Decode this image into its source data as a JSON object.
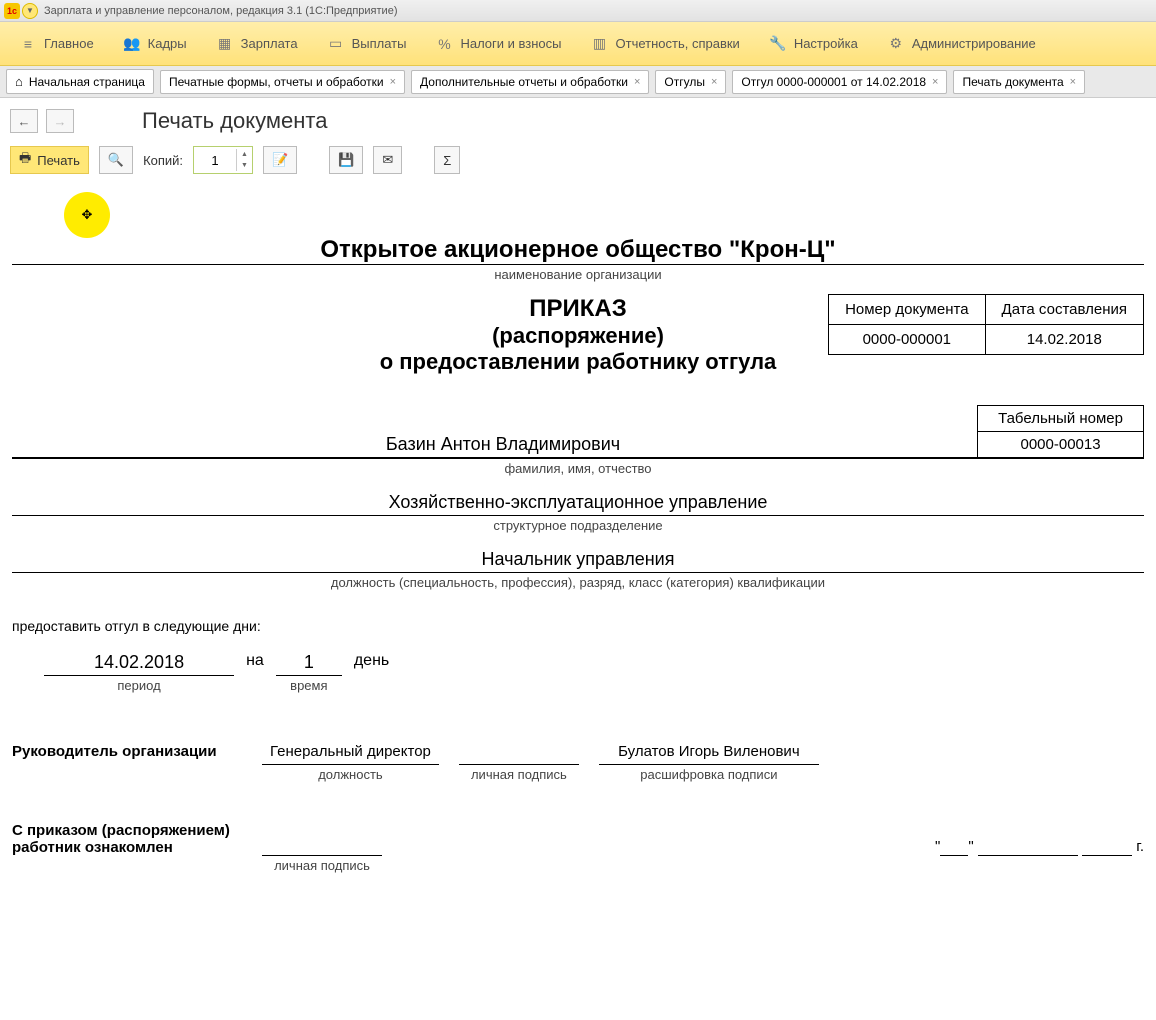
{
  "titlebar": {
    "text": "Зарплата и управление персоналом, редакция 3.1  (1С:Предприятие)"
  },
  "menu": {
    "items": [
      {
        "label": "Главное"
      },
      {
        "label": "Кадры"
      },
      {
        "label": "Зарплата"
      },
      {
        "label": "Выплаты"
      },
      {
        "label": "Налоги и взносы"
      },
      {
        "label": "Отчетность, справки"
      },
      {
        "label": "Настройка"
      },
      {
        "label": "Администрирование"
      }
    ]
  },
  "tabs": {
    "items": [
      {
        "label": "Начальная страница",
        "home": true
      },
      {
        "label": "Печатные формы, отчеты и обработки",
        "close": true
      },
      {
        "label": "Дополнительные отчеты и обработки",
        "close": true
      },
      {
        "label": "Отгулы",
        "close": true
      },
      {
        "label": "Отгул 0000-000001 от 14.02.2018",
        "close": true
      },
      {
        "label": "Печать документа",
        "close": true,
        "active": true
      }
    ]
  },
  "page": {
    "title": "Печать документа"
  },
  "toolbar": {
    "print_label": "Печать",
    "copies_label": "Копий:",
    "copies_value": "1"
  },
  "doc": {
    "org_name": "Открытое акционерное общество \"Крон-Ц\"",
    "org_caption": "наименование организации",
    "doc_num_header": "Номер документа",
    "doc_date_header": "Дата составления",
    "doc_num": "0000-000001",
    "doc_date": "14.02.2018",
    "order_t1": "ПРИКАЗ",
    "order_t2": "(распоряжение)",
    "order_t3": "о предоставлении работнику отгула",
    "tabnum_header": "Табельный номер",
    "tabnum": "0000-00013",
    "fio": "Базин Антон Владимирович",
    "fio_caption": "фамилия, имя, отчество",
    "dept": "Хозяйственно-эксплуатационное управление",
    "dept_caption": "структурное подразделение",
    "position": "Начальник управления",
    "position_caption": "должность (специальность, профессия), разряд, класс (категория) квалификации",
    "grant_text": "предоставить отгул в следующие дни:",
    "period_val": "14.02.2018",
    "period_caption": "период",
    "na_label": "на",
    "days_val": "1",
    "days_caption": "время",
    "day_word": "день",
    "head_label": "Руководитель организации",
    "head_pos": "Генеральный директор",
    "head_pos_caption": "должность",
    "sign_caption": "личная подпись",
    "head_name": "Булатов Игорь Виленович",
    "decode_caption": "расшифровка подписи",
    "ack_label_l1": "С приказом (распоряжением)",
    "ack_label_l2": "работник ознакомлен",
    "year_suffix": "г."
  }
}
